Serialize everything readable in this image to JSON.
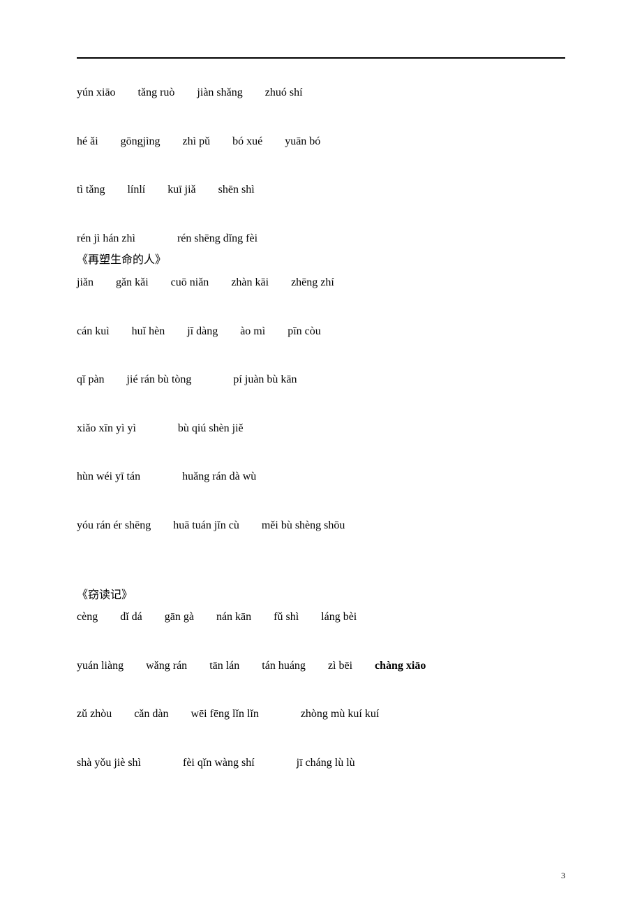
{
  "page_number": "3",
  "section1": {
    "lines": [
      [
        "yún xiāo",
        "tǎng ruò",
        "jiàn shǎng",
        "zhuó shí"
      ],
      [
        "hé ǎi",
        "gōngjìng",
        "zhì pǔ",
        "bó xué",
        "yuān bó"
      ],
      [
        "tì tǎng",
        "línlí",
        "kuī jiǎ",
        "shēn shì"
      ],
      [
        "rén jì hán zhì",
        "rén shēng dǐng fèi"
      ]
    ]
  },
  "section2": {
    "title": "《再塑生命的人》",
    "lines": [
      [
        "jiǎn",
        "gǎn kǎi",
        "cuō niǎn",
        "zhàn kāi",
        "zhēng zhí"
      ],
      [
        "cán kuì",
        "huǐ hèn",
        "jī dàng",
        "ào mì",
        "pīn còu"
      ],
      [
        "qǐ pàn",
        "jié rán bù tòng",
        "pí juàn bù kān"
      ],
      [
        "xiǎo xīn yì yì",
        "bù qiú shèn jiě"
      ],
      [
        "hùn wéi yī tán",
        "huǎng rán dà wù"
      ],
      [
        "yóu rán ér shēng",
        "huā tuán jǐn cù",
        "měi bù shèng shōu"
      ]
    ]
  },
  "section3": {
    "title": "《窃读记》",
    "lines": [
      [
        "cèng",
        "dǐ dá",
        "gān gà",
        "nán kān",
        "fǔ shì",
        "láng bèi"
      ],
      [
        "yuán liàng",
        "wǎng rán",
        "tān lán",
        "tán huáng",
        "zì bēi",
        "chàng xiāo"
      ],
      [
        "zǔ zhòu",
        "cǎn dàn",
        "wēi fēng lǐn lǐn",
        "zhòng mù kuí kuí"
      ],
      [
        "shà yǒu jiè shì",
        "fèi qǐn wàng shí",
        "jī cháng lù lù"
      ]
    ],
    "bold_index": {
      "line": 1,
      "item": 5
    }
  }
}
